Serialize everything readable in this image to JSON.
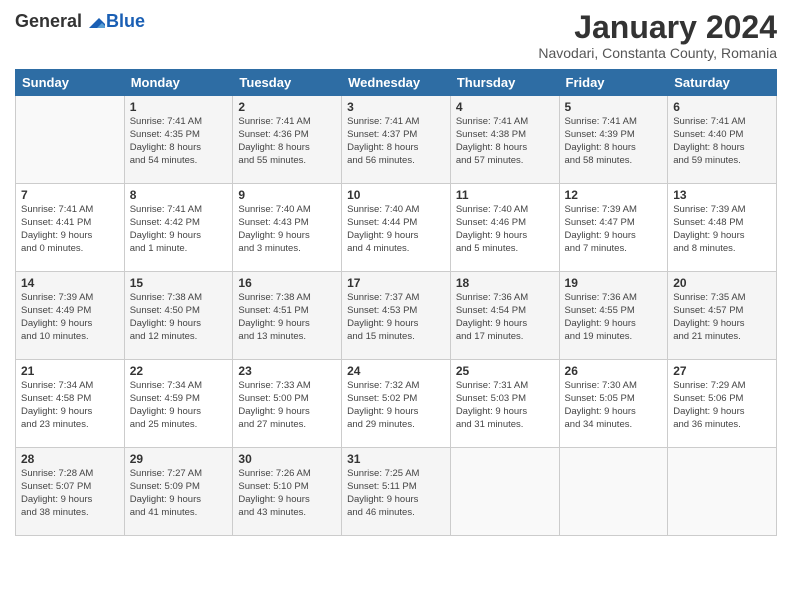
{
  "logo": {
    "general": "General",
    "blue": "Blue"
  },
  "title": "January 2024",
  "subtitle": "Navodari, Constanta County, Romania",
  "days": [
    "Sunday",
    "Monday",
    "Tuesday",
    "Wednesday",
    "Thursday",
    "Friday",
    "Saturday"
  ],
  "weeks": [
    [
      {
        "day": "",
        "content": ""
      },
      {
        "day": "1",
        "content": "Sunrise: 7:41 AM\nSunset: 4:35 PM\nDaylight: 8 hours\nand 54 minutes."
      },
      {
        "day": "2",
        "content": "Sunrise: 7:41 AM\nSunset: 4:36 PM\nDaylight: 8 hours\nand 55 minutes."
      },
      {
        "day": "3",
        "content": "Sunrise: 7:41 AM\nSunset: 4:37 PM\nDaylight: 8 hours\nand 56 minutes."
      },
      {
        "day": "4",
        "content": "Sunrise: 7:41 AM\nSunset: 4:38 PM\nDaylight: 8 hours\nand 57 minutes."
      },
      {
        "day": "5",
        "content": "Sunrise: 7:41 AM\nSunset: 4:39 PM\nDaylight: 8 hours\nand 58 minutes."
      },
      {
        "day": "6",
        "content": "Sunrise: 7:41 AM\nSunset: 4:40 PM\nDaylight: 8 hours\nand 59 minutes."
      }
    ],
    [
      {
        "day": "7",
        "content": "Sunrise: 7:41 AM\nSunset: 4:41 PM\nDaylight: 9 hours\nand 0 minutes."
      },
      {
        "day": "8",
        "content": "Sunrise: 7:41 AM\nSunset: 4:42 PM\nDaylight: 9 hours\nand 1 minute."
      },
      {
        "day": "9",
        "content": "Sunrise: 7:40 AM\nSunset: 4:43 PM\nDaylight: 9 hours\nand 3 minutes."
      },
      {
        "day": "10",
        "content": "Sunrise: 7:40 AM\nSunset: 4:44 PM\nDaylight: 9 hours\nand 4 minutes."
      },
      {
        "day": "11",
        "content": "Sunrise: 7:40 AM\nSunset: 4:46 PM\nDaylight: 9 hours\nand 5 minutes."
      },
      {
        "day": "12",
        "content": "Sunrise: 7:39 AM\nSunset: 4:47 PM\nDaylight: 9 hours\nand 7 minutes."
      },
      {
        "day": "13",
        "content": "Sunrise: 7:39 AM\nSunset: 4:48 PM\nDaylight: 9 hours\nand 8 minutes."
      }
    ],
    [
      {
        "day": "14",
        "content": "Sunrise: 7:39 AM\nSunset: 4:49 PM\nDaylight: 9 hours\nand 10 minutes."
      },
      {
        "day": "15",
        "content": "Sunrise: 7:38 AM\nSunset: 4:50 PM\nDaylight: 9 hours\nand 12 minutes."
      },
      {
        "day": "16",
        "content": "Sunrise: 7:38 AM\nSunset: 4:51 PM\nDaylight: 9 hours\nand 13 minutes."
      },
      {
        "day": "17",
        "content": "Sunrise: 7:37 AM\nSunset: 4:53 PM\nDaylight: 9 hours\nand 15 minutes."
      },
      {
        "day": "18",
        "content": "Sunrise: 7:36 AM\nSunset: 4:54 PM\nDaylight: 9 hours\nand 17 minutes."
      },
      {
        "day": "19",
        "content": "Sunrise: 7:36 AM\nSunset: 4:55 PM\nDaylight: 9 hours\nand 19 minutes."
      },
      {
        "day": "20",
        "content": "Sunrise: 7:35 AM\nSunset: 4:57 PM\nDaylight: 9 hours\nand 21 minutes."
      }
    ],
    [
      {
        "day": "21",
        "content": "Sunrise: 7:34 AM\nSunset: 4:58 PM\nDaylight: 9 hours\nand 23 minutes."
      },
      {
        "day": "22",
        "content": "Sunrise: 7:34 AM\nSunset: 4:59 PM\nDaylight: 9 hours\nand 25 minutes."
      },
      {
        "day": "23",
        "content": "Sunrise: 7:33 AM\nSunset: 5:00 PM\nDaylight: 9 hours\nand 27 minutes."
      },
      {
        "day": "24",
        "content": "Sunrise: 7:32 AM\nSunset: 5:02 PM\nDaylight: 9 hours\nand 29 minutes."
      },
      {
        "day": "25",
        "content": "Sunrise: 7:31 AM\nSunset: 5:03 PM\nDaylight: 9 hours\nand 31 minutes."
      },
      {
        "day": "26",
        "content": "Sunrise: 7:30 AM\nSunset: 5:05 PM\nDaylight: 9 hours\nand 34 minutes."
      },
      {
        "day": "27",
        "content": "Sunrise: 7:29 AM\nSunset: 5:06 PM\nDaylight: 9 hours\nand 36 minutes."
      }
    ],
    [
      {
        "day": "28",
        "content": "Sunrise: 7:28 AM\nSunset: 5:07 PM\nDaylight: 9 hours\nand 38 minutes."
      },
      {
        "day": "29",
        "content": "Sunrise: 7:27 AM\nSunset: 5:09 PM\nDaylight: 9 hours\nand 41 minutes."
      },
      {
        "day": "30",
        "content": "Sunrise: 7:26 AM\nSunset: 5:10 PM\nDaylight: 9 hours\nand 43 minutes."
      },
      {
        "day": "31",
        "content": "Sunrise: 7:25 AM\nSunset: 5:11 PM\nDaylight: 9 hours\nand 46 minutes."
      },
      {
        "day": "",
        "content": ""
      },
      {
        "day": "",
        "content": ""
      },
      {
        "day": "",
        "content": ""
      }
    ]
  ]
}
